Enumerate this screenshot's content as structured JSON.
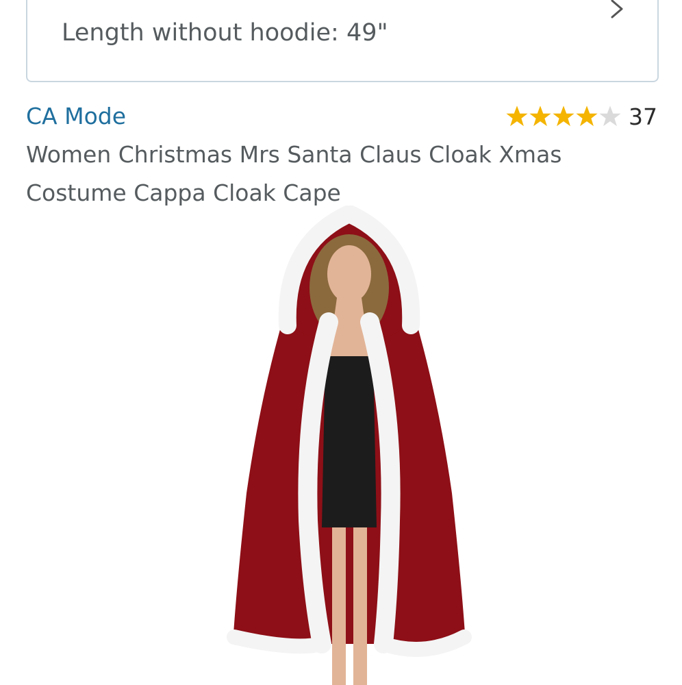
{
  "spec": {
    "text": "Length without hoodie: 49\""
  },
  "product": {
    "brand": "CA Mode",
    "rating_stars": 4,
    "rating_max": 5,
    "rating_count": "37",
    "title": "Women Christmas Mrs Santa Claus Cloak Xmas Costume Cappa Cloak Cape"
  },
  "colors": {
    "brand_link": "#1f6f9e",
    "star_filled": "#f4b400",
    "star_empty": "#dadada",
    "cloak_red": "#8e0f17",
    "box_border": "#c9d6e0"
  },
  "icons": {
    "chevron": "chevron-right-icon",
    "star": "star-icon"
  }
}
